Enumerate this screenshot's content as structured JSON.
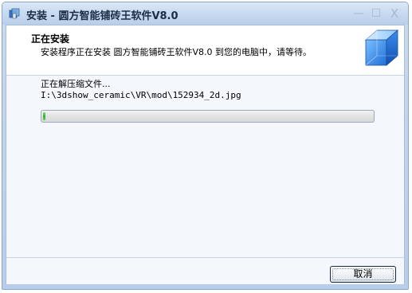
{
  "window": {
    "title": "安装 - 圆方智能铺砖王软件V8.0",
    "min_glyph": "—",
    "max_glyph": "☐",
    "close_glyph": "X"
  },
  "header": {
    "title": "正在安装",
    "subtitle": "安装程序正在安装 圆方智能铺砖王软件V8.0 到您的电脑中，请等待。"
  },
  "progress": {
    "status": "正在解压缩文件...",
    "current_file": "I:\\3dshow_ceramic\\VR\\mod\\152934_2d.jpg",
    "fraction": 0.005
  },
  "footer": {
    "cancel_label": "取消"
  },
  "colors": {
    "accent": "#2fb32f",
    "title_bar": "#c5d8ef",
    "window_frame": "#b7cdea"
  },
  "icons": {
    "app": "installer-app-icon",
    "graphic": "blue-cube-graphic"
  }
}
